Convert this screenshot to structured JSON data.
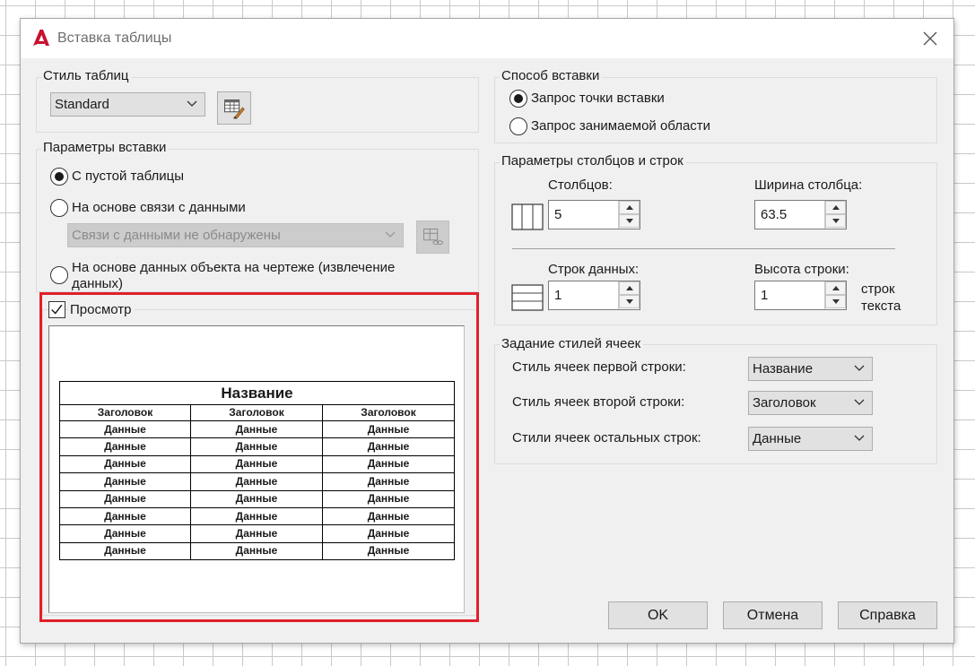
{
  "window": {
    "title": "Вставка таблицы"
  },
  "table_style": {
    "legend": "Стиль таблиц",
    "selected": "Standard"
  },
  "insert_options": {
    "legend": "Параметры вставки",
    "options": [
      {
        "label": "С пустой таблицы",
        "checked": true
      },
      {
        "label": "На основе связи с данными",
        "checked": false
      },
      {
        "label": "На основе данных объекта на чертеже (извлечение",
        "label_line2": "данных)",
        "checked": false
      }
    ],
    "data_link_combo": "Связи с данными не обнаружены"
  },
  "preview": {
    "label": "Просмотр",
    "checked": true,
    "table": {
      "title": "Название",
      "headers": [
        "Заголовок",
        "Заголовок",
        "Заголовок"
      ],
      "rows": [
        [
          "Данные",
          "Данные",
          "Данные"
        ],
        [
          "Данные",
          "Данные",
          "Данные"
        ],
        [
          "Данные",
          "Данные",
          "Данные"
        ],
        [
          "Данные",
          "Данные",
          "Данные"
        ],
        [
          "Данные",
          "Данные",
          "Данные"
        ],
        [
          "Данные",
          "Данные",
          "Данные"
        ],
        [
          "Данные",
          "Данные",
          "Данные"
        ],
        [
          "Данные",
          "Данные",
          "Данные"
        ]
      ]
    }
  },
  "insertion_method": {
    "legend": "Способ вставки",
    "options": [
      {
        "label": "Запрос точки вставки",
        "checked": true
      },
      {
        "label": "Запрос занимаемой области",
        "checked": false
      }
    ]
  },
  "columns_rows": {
    "legend": "Параметры столбцов и строк",
    "columns_label": "Столбцов:",
    "columns_value": "5",
    "col_width_label": "Ширина столбца:",
    "col_width_value": "63.5",
    "data_rows_label": "Строк данных:",
    "data_rows_value": "1",
    "row_height_label": "Высота строки:",
    "row_height_value": "1",
    "row_height_unit_line1": "строк",
    "row_height_unit_line2": "текста"
  },
  "cell_styles": {
    "legend": "Задание стилей ячеек",
    "first_row_label": "Стиль ячеек первой строки:",
    "first_row_value": "Название",
    "second_row_label": "Стиль ячеек второй строки:",
    "second_row_value": "Заголовок",
    "other_rows_label": "Стили ячеек остальных строк:",
    "other_rows_value": "Данные"
  },
  "buttons": {
    "ok": "OK",
    "cancel": "Отмена",
    "help": "Справка"
  },
  "colors": {
    "highlight_frame": "#e0202a",
    "app_icon": "#c8102e"
  }
}
